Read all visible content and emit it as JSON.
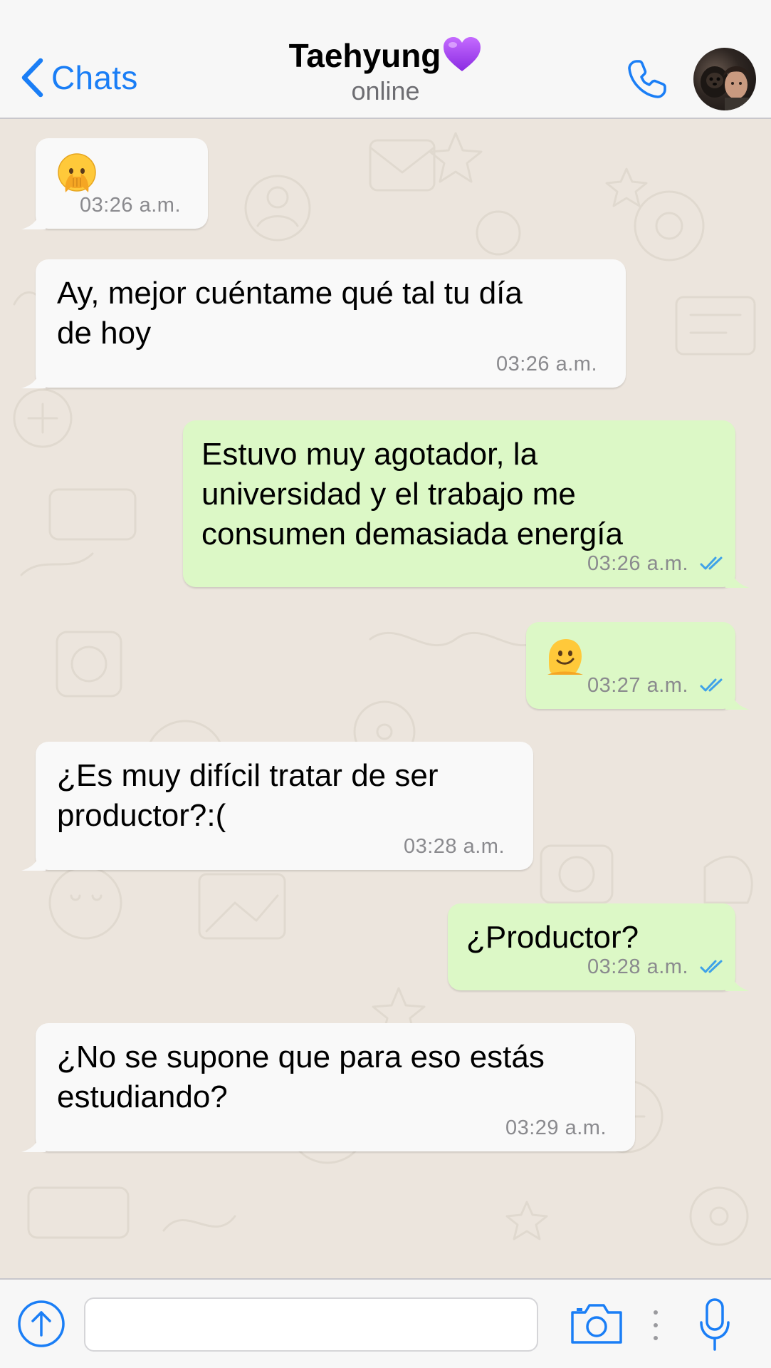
{
  "header": {
    "back_label": "Chats",
    "contact_name": "Taehyung",
    "contact_status": "online",
    "heart_icon": "purple-heart-emoji",
    "call_icon": "phone-icon",
    "accent_color": "#1a7ef6"
  },
  "messages": [
    {
      "direction": "in",
      "emoji": "face-with-open-eyes-and-hand-over-mouth",
      "time": "03:26 a.m."
    },
    {
      "direction": "in",
      "text": "Ay, mejor cuéntame qué tal tu día\nde hoy",
      "time": "03:26 a.m."
    },
    {
      "direction": "out",
      "text": "Estuvo muy agotador, la\nuniversidad y el trabajo me\nconsumen demasiada energía",
      "time": "03:26 a.m.",
      "status": "read"
    },
    {
      "direction": "out",
      "emoji": "melting-face",
      "time": "03:27 a.m.",
      "status": "read"
    },
    {
      "direction": "in",
      "text": "¿Es muy difícil tratar de ser\nproductor?:(",
      "time": "03:28 a.m."
    },
    {
      "direction": "out",
      "text": "¿Productor?",
      "time": "03:28 a.m.",
      "status": "read"
    },
    {
      "direction": "in",
      "text": "¿No se supone que para eso estás\nestudiando?",
      "time": "03:29 a.m."
    }
  ],
  "input_bar": {
    "message_value": "",
    "attach_icon": "upload-arrow-icon",
    "camera_icon": "camera-icon",
    "mic_icon": "microphone-icon"
  },
  "colors": {
    "incoming_bubble": "#f9f9f9",
    "outgoing_bubble": "#dcf8c6",
    "chat_background": "#ece5dd",
    "read_ticks": "#3fa2e8"
  }
}
